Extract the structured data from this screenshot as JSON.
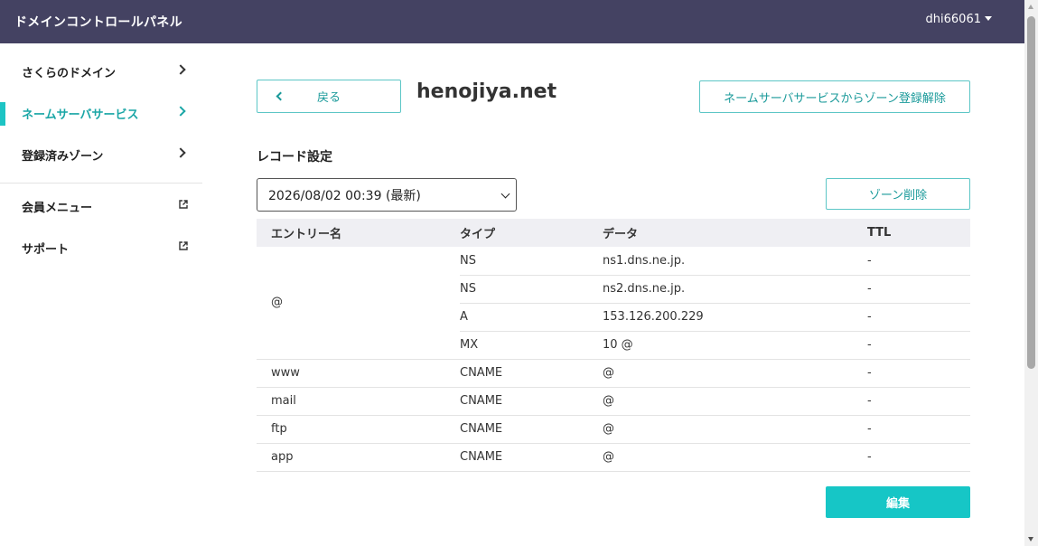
{
  "header": {
    "title": "ドメインコントロールパネル",
    "user": "dhi66061"
  },
  "sidebar": {
    "items": [
      {
        "label": "さくらのドメイン",
        "icon": "chevron-right-icon",
        "active": false
      },
      {
        "label": "ネームサーバサービス",
        "icon": "chevron-right-icon",
        "active": true
      },
      {
        "label": "登録済みゾーン",
        "icon": "chevron-right-icon",
        "active": false
      }
    ],
    "links": [
      {
        "label": "会員メニュー",
        "icon": "external-link-icon"
      },
      {
        "label": "サポート",
        "icon": "external-link-icon"
      }
    ]
  },
  "main": {
    "back_label": "戻る",
    "domain": "henojiya.net",
    "unregister_label": "ネームサーバサービスからゾーン登録解除",
    "section_title": "レコード設定",
    "version_select": {
      "value": "2026/08/02 00:39 (最新)"
    },
    "delete_zone_label": "ゾーン削除",
    "table": {
      "headers": [
        "エントリー名",
        "タイプ",
        "データ",
        "TTL"
      ],
      "groups": [
        {
          "entry": "@",
          "records": [
            {
              "type": "NS",
              "data": "ns1.dns.ne.jp.",
              "ttl": "-"
            },
            {
              "type": "NS",
              "data": "ns2.dns.ne.jp.",
              "ttl": "-"
            },
            {
              "type": "A",
              "data": "153.126.200.229",
              "ttl": "-"
            },
            {
              "type": "MX",
              "data": "10 @",
              "ttl": "-"
            }
          ]
        },
        {
          "entry": "www",
          "records": [
            {
              "type": "CNAME",
              "data": "@",
              "ttl": "-"
            }
          ]
        },
        {
          "entry": "mail",
          "records": [
            {
              "type": "CNAME",
              "data": "@",
              "ttl": "-"
            }
          ]
        },
        {
          "entry": "ftp",
          "records": [
            {
              "type": "CNAME",
              "data": "@",
              "ttl": "-"
            }
          ]
        },
        {
          "entry": "app",
          "records": [
            {
              "type": "CNAME",
              "data": "@",
              "ttl": "-"
            }
          ]
        }
      ]
    },
    "edit_label": "編集"
  },
  "colors": {
    "header_bg": "#444262",
    "accent": "#16c6c6",
    "accent_text": "#1a9a9a"
  }
}
